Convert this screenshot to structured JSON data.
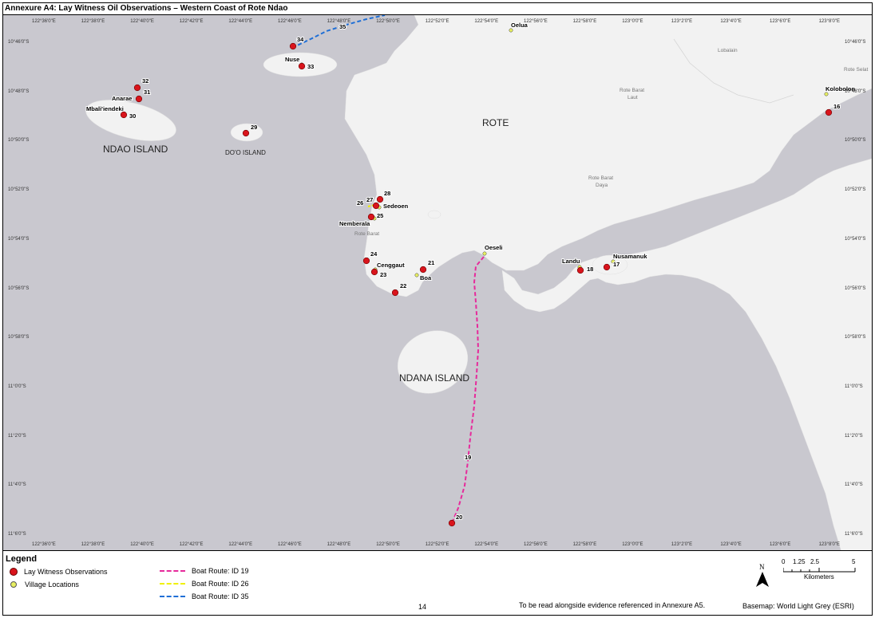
{
  "title": "Annexure A4: Lay Witness Oil Observations – Western Coast of Rote Ndao",
  "longitude_ticks": [
    "122°36'0\"E",
    "122°38'0\"E",
    "122°40'0\"E",
    "122°42'0\"E",
    "122°44'0\"E",
    "122°46'0\"E",
    "122°48'0\"E",
    "122°50'0\"E",
    "122°52'0\"E",
    "122°54'0\"E",
    "122°56'0\"E",
    "122°58'0\"E",
    "123°0'0\"E",
    "123°2'0\"E",
    "123°4'0\"E",
    "123°6'0\"E",
    "123°8'0\"E"
  ],
  "latitude_ticks": [
    "10°46'0\"S",
    "10°48'0\"S",
    "10°50'0\"S",
    "10°52'0\"S",
    "10°54'0\"S",
    "10°56'0\"S",
    "10°58'0\"S",
    "11°0'0\"S",
    "11°2'0\"S",
    "11°4'0\"S",
    "11°6'0\"S"
  ],
  "place_names": {
    "rote": "ROTE",
    "ndao": "NDAO ISLAND",
    "doo": "DO'O ISLAND",
    "ndana": "NDANA ISLAND",
    "lobalain": "Lobalain",
    "rote_selatan": "Rote Selat",
    "rote_barat_laut_1": "Rote Barat",
    "rote_barat_laut_2": "Laut",
    "rote_barat_daya_1": "Rote Barat",
    "rote_barat_daya_2": "Daya",
    "rote_barat": "Rote Barat"
  },
  "observations": [
    {
      "id": "16"
    },
    {
      "id": "17"
    },
    {
      "id": "18"
    },
    {
      "id": "19"
    },
    {
      "id": "20"
    },
    {
      "id": "21"
    },
    {
      "id": "22"
    },
    {
      "id": "23"
    },
    {
      "id": "24"
    },
    {
      "id": "25"
    },
    {
      "id": "26"
    },
    {
      "id": "27"
    },
    {
      "id": "28"
    },
    {
      "id": "29"
    },
    {
      "id": "30"
    },
    {
      "id": "31"
    },
    {
      "id": "32"
    },
    {
      "id": "33"
    },
    {
      "id": "34"
    },
    {
      "id": "35"
    }
  ],
  "villages": [
    "Oelua",
    "Kolobolon",
    "Nusamanuk",
    "Landu",
    "Oeseli",
    "Boa",
    "Cenggaut",
    "Sedeoen",
    "Nemberala",
    "Mbali'iendeki",
    "Anarae",
    "Nuse"
  ],
  "legend": {
    "title": "Legend",
    "observations": "Lay Witness Observations",
    "villages": "Village Locations",
    "route19": "Boat Route: ID 19",
    "route26": "Boat Route: ID 26",
    "route35": "Boat Route: ID 35"
  },
  "colors": {
    "water": "#c9c8cf",
    "land": "#f2f2f2",
    "observation": "#d9141c",
    "village": "#e7ef61",
    "route19": "#e62a9b",
    "route26": "#f0f000",
    "route35": "#1f6fd6"
  },
  "scale": {
    "ticks": [
      "0",
      "1.25",
      "2.5",
      "5"
    ],
    "unit": "Kilometers"
  },
  "north_label": "N",
  "page_number": "14",
  "note": "To be read alongside evidence referenced in Annexure A5.",
  "basemap": "Basemap: World Light Grey (ESRI)"
}
